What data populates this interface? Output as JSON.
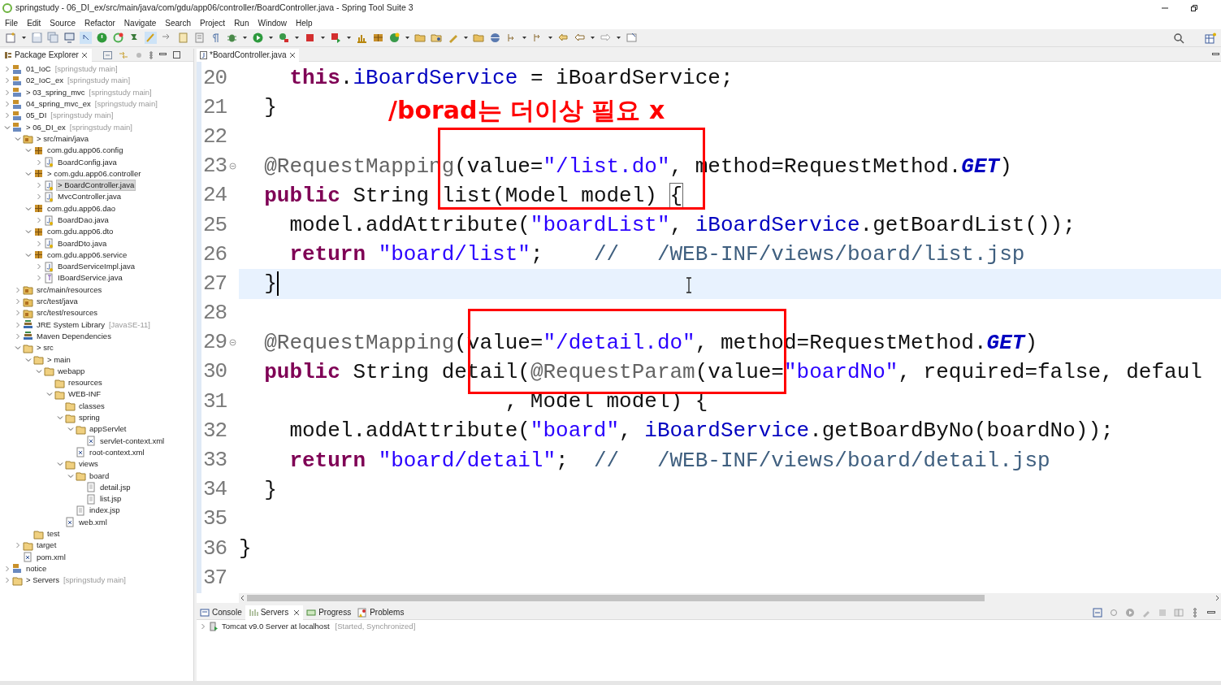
{
  "window": {
    "title": "springstudy - 06_DI_ex/src/main/java/com/gdu/app06/controller/BoardController.java - Spring Tool Suite 3"
  },
  "menu": [
    "File",
    "Edit",
    "Source",
    "Refactor",
    "Navigate",
    "Search",
    "Project",
    "Run",
    "Window",
    "Help"
  ],
  "package_explorer": {
    "title": "Package Explorer",
    "tree": [
      {
        "label": "01_IoC",
        "decoration": "[springstudy main]",
        "kind": "project",
        "expanded": false
      },
      {
        "label": "02_IoC_ex",
        "decoration": "[springstudy main]",
        "kind": "project",
        "expanded": false
      },
      {
        "label": "> 03_spring_mvc",
        "decoration": "[springstudy main]",
        "kind": "project",
        "expanded": false
      },
      {
        "label": "04_spring_mvc_ex",
        "decoration": "[springstudy main]",
        "kind": "project",
        "expanded": false
      },
      {
        "label": "05_DI",
        "decoration": "[springstudy main]",
        "kind": "project",
        "expanded": false
      },
      {
        "label": "> 06_DI_ex",
        "decoration": "[springstudy main]",
        "kind": "project",
        "expanded": true,
        "children": [
          {
            "label": "> src/main/java",
            "kind": "source",
            "expanded": true,
            "children": [
              {
                "label": "com.gdu.app06.config",
                "kind": "package",
                "expanded": true,
                "children": [
                  {
                    "label": "BoardConfig.java",
                    "kind": "java",
                    "expanded": false
                  }
                ]
              },
              {
                "label": "> com.gdu.app06.controller",
                "kind": "package",
                "expanded": true,
                "children": [
                  {
                    "label": "> BoardController.java",
                    "kind": "java",
                    "expanded": false,
                    "selected": true
                  },
                  {
                    "label": "MvcController.java",
                    "kind": "java",
                    "expanded": false
                  }
                ]
              },
              {
                "label": "com.gdu.app06.dao",
                "kind": "package",
                "expanded": true,
                "children": [
                  {
                    "label": "BoardDao.java",
                    "kind": "java",
                    "expanded": false
                  }
                ]
              },
              {
                "label": "com.gdu.app06.dto",
                "kind": "package",
                "expanded": true,
                "children": [
                  {
                    "label": "BoardDto.java",
                    "kind": "java",
                    "expanded": false
                  }
                ]
              },
              {
                "label": "com.gdu.app06.service",
                "kind": "package",
                "expanded": true,
                "children": [
                  {
                    "label": "BoardServiceImpl.java",
                    "kind": "java",
                    "expanded": false
                  },
                  {
                    "label": "IBoardService.java",
                    "kind": "interface",
                    "expanded": false
                  }
                ]
              }
            ]
          },
          {
            "label": "src/main/resources",
            "kind": "source",
            "expanded": false
          },
          {
            "label": "src/test/java",
            "kind": "source",
            "expanded": false
          },
          {
            "label": "src/test/resources",
            "kind": "source",
            "expanded": false
          },
          {
            "label": "JRE System Library",
            "decoration": "[JavaSE-11]",
            "kind": "library",
            "expanded": false
          },
          {
            "label": "Maven Dependencies",
            "kind": "library",
            "expanded": false
          },
          {
            "label": "> src",
            "kind": "folder",
            "expanded": true,
            "children": [
              {
                "label": "> main",
                "kind": "folder",
                "expanded": true,
                "children": [
                  {
                    "label": "webapp",
                    "kind": "folder",
                    "expanded": true,
                    "children": [
                      {
                        "label": "resources",
                        "kind": "folder"
                      },
                      {
                        "label": "WEB-INF",
                        "kind": "folder",
                        "expanded": true,
                        "children": [
                          {
                            "label": "classes",
                            "kind": "folder"
                          },
                          {
                            "label": "spring",
                            "kind": "folder",
                            "expanded": true,
                            "children": [
                              {
                                "label": "appServlet",
                                "kind": "folder",
                                "expanded": true,
                                "children": [
                                  {
                                    "label": "servlet-context.xml",
                                    "kind": "xml"
                                  }
                                ]
                              },
                              {
                                "label": "root-context.xml",
                                "kind": "xml"
                              }
                            ]
                          },
                          {
                            "label": "views",
                            "kind": "folder",
                            "expanded": true,
                            "children": [
                              {
                                "label": "board",
                                "kind": "folder",
                                "expanded": true,
                                "children": [
                                  {
                                    "label": "detail.jsp",
                                    "kind": "jsp"
                                  },
                                  {
                                    "label": "list.jsp",
                                    "kind": "jsp"
                                  }
                                ]
                              },
                              {
                                "label": "index.jsp",
                                "kind": "jsp"
                              }
                            ]
                          },
                          {
                            "label": "web.xml",
                            "kind": "xml"
                          }
                        ]
                      }
                    ]
                  }
                ]
              },
              {
                "label": "test",
                "kind": "folder"
              }
            ]
          },
          {
            "label": "target",
            "kind": "folder",
            "expanded": false
          },
          {
            "label": "pom.xml",
            "kind": "xml"
          }
        ]
      },
      {
        "label": "notice",
        "kind": "project",
        "expanded": false
      },
      {
        "label": "> Servers",
        "decoration": "[springstudy main]",
        "kind": "folder",
        "expanded": false
      }
    ]
  },
  "editor": {
    "tab": "*BoardController.java",
    "lines": [
      {
        "number": "20",
        "tokens": [
          {
            "kind": "keyword",
            "text": "    this"
          },
          {
            "kind": "plain",
            "text": "."
          },
          {
            "kind": "field",
            "text": "iBoardService"
          },
          {
            "kind": "plain",
            "text": " = iBoardService;"
          }
        ]
      },
      {
        "number": "21",
        "tokens": [
          {
            "kind": "plain",
            "text": "  }"
          }
        ]
      },
      {
        "number": "22"
      },
      {
        "number": "23",
        "foldable": true,
        "tokens": [
          {
            "kind": "annotation",
            "text": "  @RequestMapping"
          },
          {
            "kind": "plain",
            "text": "(value="
          },
          {
            "kind": "string",
            "text": "\"/list.do\""
          },
          {
            "kind": "plain",
            "text": ", method=RequestMethod."
          },
          {
            "kind": "constant",
            "text": "GET"
          },
          {
            "kind": "plain",
            "text": ")"
          }
        ]
      },
      {
        "number": "24",
        "tokens": [
          {
            "kind": "keyword",
            "text": "  public"
          },
          {
            "kind": "plain",
            "text": " String list(Model model) "
          },
          {
            "kind": "plain",
            "text": "{",
            "boxed": true
          }
        ]
      },
      {
        "number": "25",
        "tokens": [
          {
            "kind": "plain",
            "text": "    model.addAttribute("
          },
          {
            "kind": "string",
            "text": "\"boardList\""
          },
          {
            "kind": "plain",
            "text": ", "
          },
          {
            "kind": "field",
            "text": "iBoardService"
          },
          {
            "kind": "plain",
            "text": ".getBoardList());"
          }
        ]
      },
      {
        "number": "26",
        "tokens": [
          {
            "kind": "keyword",
            "text": "    return"
          },
          {
            "kind": "string",
            "text": " \"board/list\""
          },
          {
            "kind": "plain",
            "text": ";    "
          },
          {
            "kind": "comment",
            "text": "//   /WEB-INF/views/board/list.jsp"
          }
        ]
      },
      {
        "number": "27",
        "current": true,
        "tokens": [
          {
            "kind": "plain",
            "text": "  }"
          }
        ]
      },
      {
        "number": "28"
      },
      {
        "number": "29",
        "foldable": true,
        "tokens": [
          {
            "kind": "annotation",
            "text": "  @RequestMapping"
          },
          {
            "kind": "plain",
            "text": "(value="
          },
          {
            "kind": "string",
            "text": "\"/detail.do\""
          },
          {
            "kind": "plain",
            "text": ", method=RequestMethod."
          },
          {
            "kind": "constant",
            "text": "GET"
          },
          {
            "kind": "plain",
            "text": ")"
          }
        ]
      },
      {
        "number": "30",
        "tokens": [
          {
            "kind": "keyword",
            "text": "  public"
          },
          {
            "kind": "plain",
            "text": " String detail("
          },
          {
            "kind": "annotation",
            "text": "@RequestParam"
          },
          {
            "kind": "plain",
            "text": "(value="
          },
          {
            "kind": "string",
            "text": "\"boardNo\""
          },
          {
            "kind": "plain",
            "text": ", required=false, defaul"
          }
        ]
      },
      {
        "number": "31",
        "tokens": [
          {
            "kind": "plain",
            "text": "                     , Model model) {"
          }
        ]
      },
      {
        "number": "32",
        "tokens": [
          {
            "kind": "plain",
            "text": "    model.addAttribute("
          },
          {
            "kind": "string",
            "text": "\"board\""
          },
          {
            "kind": "plain",
            "text": ", "
          },
          {
            "kind": "field",
            "text": "iBoardService"
          },
          {
            "kind": "plain",
            "text": ".getBoardByNo(boardNo));"
          }
        ]
      },
      {
        "number": "33",
        "tokens": [
          {
            "kind": "keyword",
            "text": "    return"
          },
          {
            "kind": "string",
            "text": " \"board/detail\""
          },
          {
            "kind": "plain",
            "text": ";  "
          },
          {
            "kind": "comment",
            "text": "//   /WEB-INF/views/board/detail.jsp"
          }
        ]
      },
      {
        "number": "34",
        "tokens": [
          {
            "kind": "plain",
            "text": "  }"
          }
        ]
      },
      {
        "number": "35"
      },
      {
        "number": "36",
        "tokens": [
          {
            "kind": "plain",
            "text": "}"
          }
        ]
      },
      {
        "number": "37"
      }
    ],
    "annotations": [
      {
        "kind": "text",
        "text": "/borad는 더이상 필요 x"
      },
      {
        "kind": "box"
      },
      {
        "kind": "box"
      }
    ]
  },
  "bottom_panel": {
    "tabs": [
      {
        "label": "Console",
        "selected": false
      },
      {
        "label": "Servers",
        "selected": true
      },
      {
        "label": "Progress",
        "selected": false
      },
      {
        "label": "Problems",
        "selected": false
      }
    ],
    "servers": [
      {
        "name": "Tomcat v9.0 Server at localhost",
        "state": "[Started, Synchronized]"
      }
    ]
  }
}
